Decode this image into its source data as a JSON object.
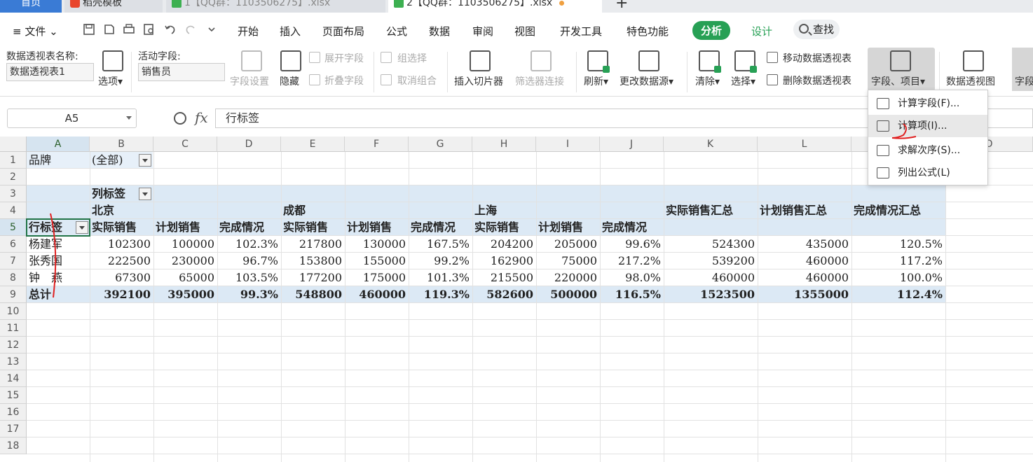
{
  "tabs": {
    "home": "首页",
    "docer": "稻壳模板",
    "file1": "1【QQ群：1103506275】.xlsx",
    "file2": "2【QQ群：1103506275】.xlsx"
  },
  "menubar": {
    "file": "文件",
    "items": [
      "开始",
      "插入",
      "页面布局",
      "公式",
      "数据",
      "审阅",
      "视图",
      "开发工具",
      "特色功能"
    ],
    "analyze": "分析",
    "design": "设计",
    "search": "查找"
  },
  "ribbon": {
    "pivot_name_label": "数据透视表名称:",
    "pivot_name_value": "数据透视表1",
    "options": "选项",
    "active_field_label": "活动字段:",
    "active_field_value": "销售员",
    "field_settings": "字段设置",
    "hide": "隐藏",
    "expand_field": "展开字段",
    "collapse_field": "折叠字段",
    "group_selection": "组选择",
    "ungroup": "取消组合",
    "insert_slicer": "插入切片器",
    "filter_connections": "筛选器连接",
    "refresh": "刷新",
    "change_source": "更改数据源",
    "clear": "清除",
    "select": "选择",
    "move_pivot": "移动数据透视表",
    "delete_pivot": "删除数据透视表",
    "fields_items": "字段、项目",
    "pivot_chart": "数据透视图",
    "fields_cut": "字段"
  },
  "formula_bar": {
    "name_box": "A5",
    "fx": "fx",
    "content": "行标签"
  },
  "columns": [
    "A",
    "B",
    "C",
    "D",
    "E",
    "F",
    "G",
    "H",
    "I",
    "J",
    "K",
    "L",
    "O"
  ],
  "rows": [
    "1",
    "2",
    "3",
    "4",
    "5",
    "6",
    "7",
    "8",
    "9",
    "10",
    "11",
    "12",
    "13",
    "14",
    "15",
    "16",
    "17",
    "18"
  ],
  "sheet": {
    "filter_label": "品牌",
    "filter_value": "(全部)",
    "col_labels": "列标签",
    "cities": [
      "北京",
      "成都",
      "上海"
    ],
    "total_headers": [
      "实际销售汇总",
      "计划销售汇总",
      "完成情况汇总"
    ],
    "row_labels": "行标签",
    "measures": [
      "实际销售",
      "计划销售",
      "完成情况",
      "实际销售",
      "计划销售",
      "完成情况",
      "实际销售",
      "计划销售",
      "完成情况"
    ],
    "data": [
      {
        "name": "杨建军",
        "values": [
          "102300",
          "100000",
          "102.3%",
          "217800",
          "130000",
          "167.5%",
          "204200",
          "205000",
          "99.6%",
          "524300",
          "435000",
          "120.5%"
        ]
      },
      {
        "name": "张秀国",
        "values": [
          "222500",
          "230000",
          "96.7%",
          "153800",
          "155000",
          "99.2%",
          "162900",
          "75000",
          "217.2%",
          "539200",
          "460000",
          "117.2%"
        ]
      },
      {
        "name": "钟　燕",
        "values": [
          "67300",
          "65000",
          "103.5%",
          "177200",
          "175000",
          "101.3%",
          "215500",
          "220000",
          "98.0%",
          "460000",
          "460000",
          "100.0%"
        ]
      }
    ],
    "total": {
      "name": "总计",
      "values": [
        "392100",
        "395000",
        "99.3%",
        "548800",
        "460000",
        "119.3%",
        "582600",
        "500000",
        "116.5%",
        "1523500",
        "1355000",
        "112.4%"
      ]
    }
  },
  "dropdown_menu": {
    "items": [
      "计算字段(F)...",
      "计算项(I)...",
      "求解次序(S)...",
      "列出公式(L)"
    ]
  },
  "colors": {
    "accent": "#27a055",
    "pivot_band": "#dce9f5",
    "home_tab": "#3a7bd5"
  }
}
